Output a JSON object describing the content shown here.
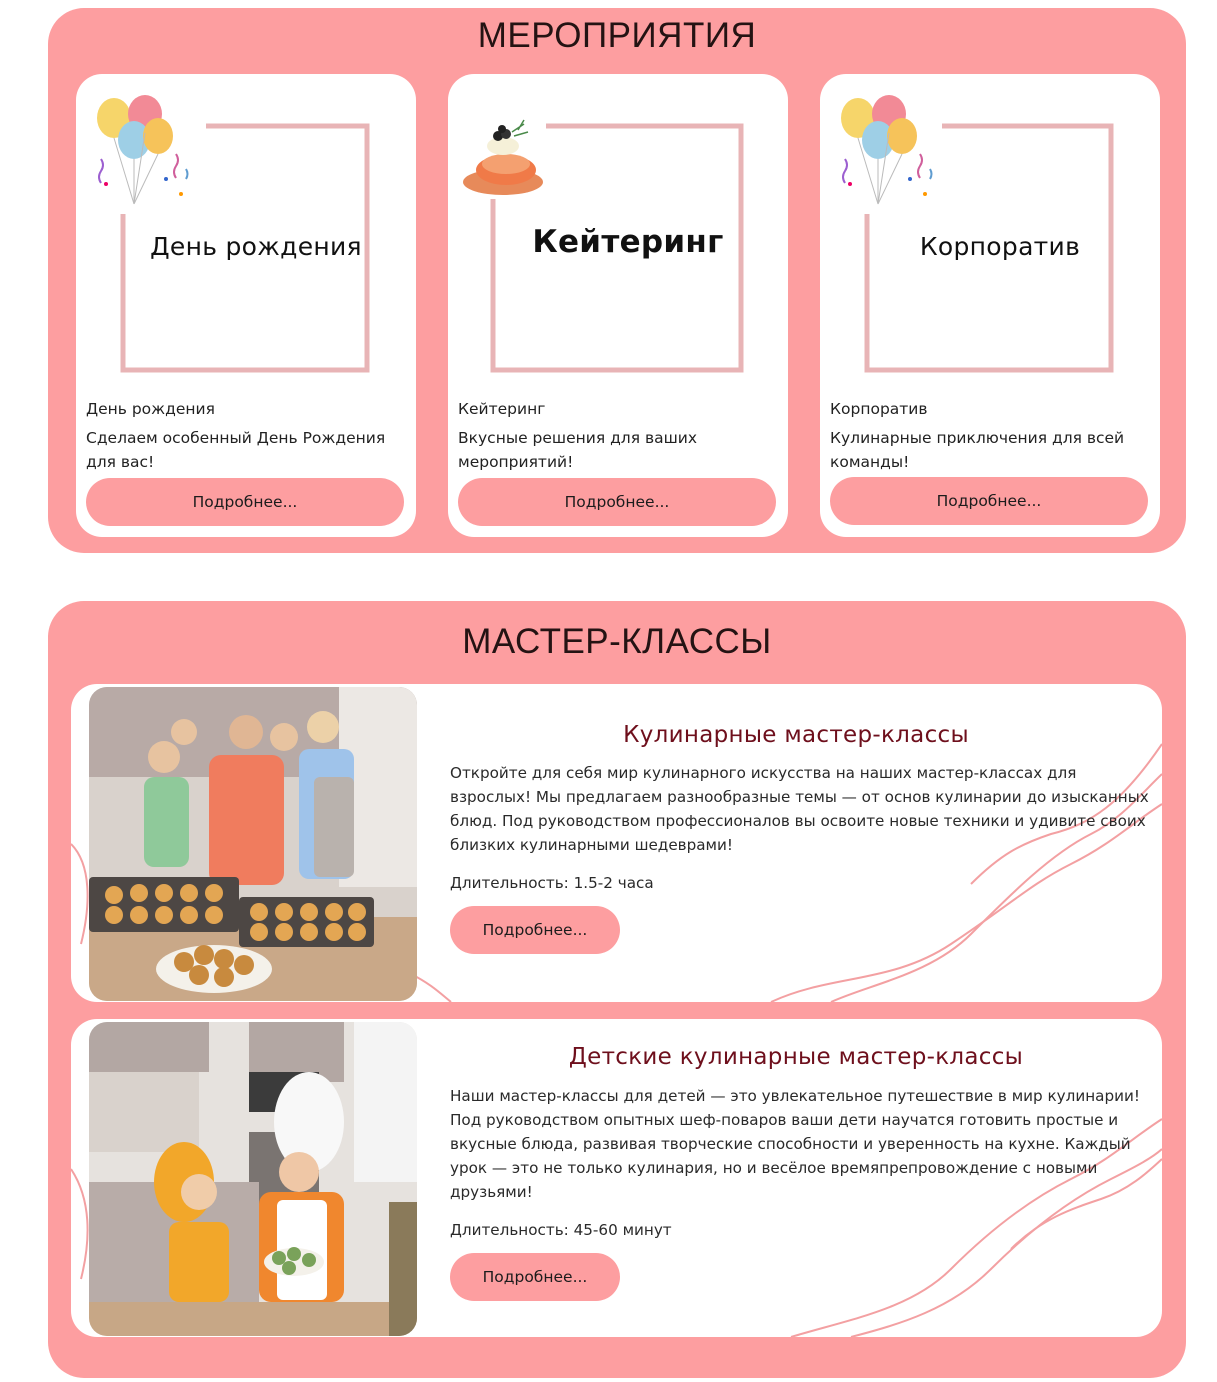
{
  "events": {
    "title": "МЕРОПРИЯТИЯ",
    "cards": [
      {
        "illustration_text": "День рождения",
        "illustration_icon": "balloons-icon",
        "title": "День рождения",
        "description": "Сделаем особенный День Рождения для вас!",
        "button": "Подробнее..."
      },
      {
        "illustration_text": "Кейтеринг",
        "illustration_icon": "food-plate-icon",
        "title": "Кейтеринг",
        "description": "Вкусные решения для ваших мероприятий!",
        "button": "Подробнее..."
      },
      {
        "illustration_text": "Корпоратив",
        "illustration_icon": "balloons-icon",
        "title": "Корпоратив",
        "description": "Кулинарные приключения для всей команды!",
        "button": "Подробнее..."
      }
    ]
  },
  "classes": {
    "title": "МАСТЕР-КЛАССЫ",
    "items": [
      {
        "title": "Кулинарные мастер-классы",
        "text": "Откройте для себя мир кулинарного искусства на наших мастер-классах для взрослых! Мы предлагаем разнообразные темы — от основ кулинарии до изысканных блюд. Под руководством профессионалов вы освоите новые техники и удивите своих близких кулинарными шедеврами!",
        "duration": "Длительность: 1.5-2 часа",
        "button": "Подробнее..."
      },
      {
        "title": "Детские кулинарные мастер-классы",
        "text": "Наши мастер-классы для детей — это увлекательное путешествие в мир кулинарии! Под руководством опытных шеф-поваров ваши дети научатся готовить простые и вкусные блюда, развивая творческие способности и уверенность на кухне. Каждый урок — это не только кулинария, но и весёлое времяпрепровождение с новыми друзьями!",
        "duration": "Длительность: 45-60 минут",
        "button": "Подробнее..."
      }
    ]
  },
  "colors": {
    "panel": "#fd9ea0",
    "frame": "#e8b4b6",
    "title_dark": "#6e0f1c"
  }
}
